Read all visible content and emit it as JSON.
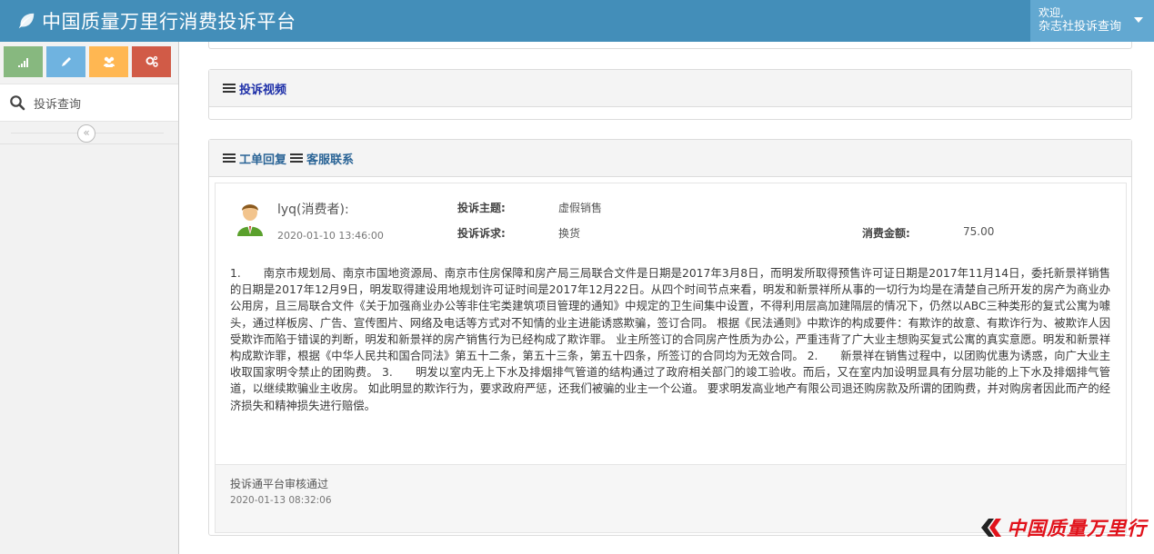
{
  "app": {
    "title": "中国质量万里行消费投诉平台",
    "icon": "leaf-icon"
  },
  "user_menu": {
    "greeting": "欢迎,",
    "username": "杂志社投诉查询"
  },
  "shortcuts": [
    {
      "icon": "signal-icon",
      "color": "#87b87f"
    },
    {
      "icon": "pencil-icon",
      "color": "#6fb3e0"
    },
    {
      "icon": "users-icon",
      "color": "#ffb752"
    },
    {
      "icon": "cogs-icon",
      "color": "#d15b47"
    }
  ],
  "sidebar": {
    "items": [
      {
        "label": "投诉查询",
        "icon": "search-icon"
      }
    ],
    "collapse_icon": "double-chevron-left-icon"
  },
  "video_panel": {
    "title": "投诉视频"
  },
  "order_panel": {
    "tab_reply": "工单回复",
    "tab_service": "客服联系"
  },
  "complaint": {
    "consumer": "lyq(消费者):",
    "time": "2020-01-10 13:46:00",
    "subject_label": "投诉主题:",
    "subject_value": "虚假销售",
    "demand_label": "投诉诉求:",
    "demand_value": "换货",
    "amount_label": "消费金额:",
    "amount_value": "75.00",
    "content": "1.　　南京市规划局、南京市国地资源局、南京市住房保障和房产局三局联合文件是日期是2017年3月8日，而明发所取得预售许可证日期是2017年11月14日，委托新景祥销售的日期是2017年12月9日，明发取得建设用地规划许可证时间是2017年12月22日。从四个时间节点来看，明发和新景祥所从事的一切行为均是在清楚自己所开发的房产为商业办公用房，且三局联合文件《关于加强商业办公等非住宅类建筑项目管理的通知》中规定的卫生间集中设置，不得利用层高加建隔层的情况下，仍然以ABC三种类形的复式公寓为噱头，通过样板房、广告、宣传图片、网络及电话等方式对不知情的业主进能诱惑欺骗，签订合同。 根据《民法通则》中欺诈的构成要件：有欺诈的故意、有欺诈行为、被欺诈人因受欺诈而陷于错误的判断，明发和新景祥的房产销售行为已经构成了欺诈罪。 业主所签订的合同房产性质为办公，严重违背了广大业主想购买复式公寓的真实意愿。明发和新景祥构成欺诈罪，根据《中华人民共和国合同法》第五十二条，第五十三条，第五十四条，所签订的合同均为无效合同。 2.　　新景祥在销售过程中，以团购优惠为诱惑，向广大业主收取国家明令禁止的团购费。 3.　　明发以室内无上下水及排烟排气管道的结构通过了政府相关部门的竣工验收。而后，又在室内加设明显具有分层功能的上下水及排烟排气管道，以继续欺骗业主收房。 如此明显的欺诈行为，要求政府严惩，还我们被骗的业主一个公道。 要求明发高业地产有限公司退还购房款及所谓的团购费，并对购房者因此而产的经济损失和精神损失进行赔偿。"
  },
  "reply": {
    "text": "投诉通平台审核通过",
    "time": "2020-01-13 08:32:06"
  },
  "watermark": {
    "text": "中国质量万里行"
  },
  "colors": {
    "navbar": "#438eb9",
    "user_menu": "#62a8d1",
    "watermark": "#e1121b"
  }
}
